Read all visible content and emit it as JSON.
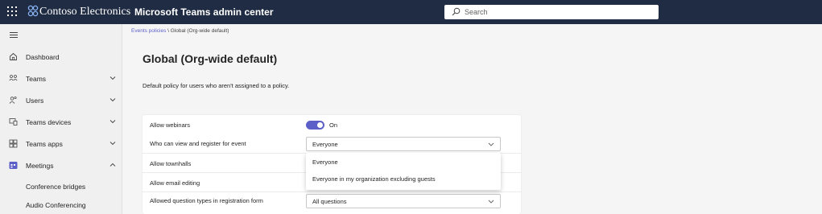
{
  "topbar": {
    "brand": "Contoso Electronics",
    "app_title": "Microsoft Teams admin center",
    "search_placeholder": "Search"
  },
  "sidebar": {
    "items": [
      {
        "label": "Dashboard",
        "icon": "home-icon"
      },
      {
        "label": "Teams",
        "icon": "teams-icon"
      },
      {
        "label": "Users",
        "icon": "users-icon"
      },
      {
        "label": "Teams devices",
        "icon": "devices-icon"
      },
      {
        "label": "Teams apps",
        "icon": "apps-icon"
      },
      {
        "label": "Meetings",
        "icon": "meetings-icon"
      }
    ],
    "sub_items": [
      "Conference bridges",
      "Audio Conferencing"
    ]
  },
  "breadcrumb": {
    "link": "Events policies",
    "separator": "\\",
    "current": "Global (Org-wide default)"
  },
  "page": {
    "title": "Global (Org-wide default)",
    "description": "Default policy for users who aren't assigned to a policy."
  },
  "settings": {
    "allow_webinars": {
      "label": "Allow webinars",
      "state": "On",
      "enabled": true
    },
    "who_can_view": {
      "label": "Who can view and register for event",
      "value": "Everyone"
    },
    "allow_townhalls": {
      "label": "Allow townhalls"
    },
    "allow_email_editing": {
      "label": "Allow email editing"
    },
    "question_types": {
      "label": "Allowed question types in registration form",
      "value": "All questions"
    }
  },
  "dropdown": {
    "options": [
      "Everyone",
      "Everyone in my organization excluding guests"
    ]
  },
  "colors": {
    "topbar": "#1f2c43",
    "accent": "#5b5fc7",
    "sidebar": "#f0f0f0",
    "background": "#f5f5f5"
  }
}
